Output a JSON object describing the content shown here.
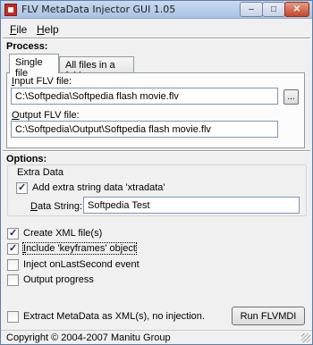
{
  "window": {
    "title": "FLV MetaData Injector GUI 1.05",
    "buttons": {
      "minimize": "–",
      "maximize": "□",
      "close": "✕"
    }
  },
  "menu": {
    "file_first": "F",
    "file_rest": "ile",
    "help_first": "H",
    "help_rest": "elp"
  },
  "process": {
    "label": "Process:",
    "tabs": [
      {
        "label": "Single file",
        "active": true
      },
      {
        "label": "All files in a folder",
        "active": false
      }
    ],
    "input_label_first": "I",
    "input_label_rest": "nput FLV file:",
    "input_value": "C:\\Softpedia\\Softpedia flash movie.flv",
    "browse_label": "...",
    "output_label_first": "O",
    "output_label_rest": "utput FLV file:",
    "output_value": "C:\\Softpedia\\Output\\Softpedia flash movie.flv"
  },
  "options": {
    "label": "Options:",
    "extra_data": {
      "title": "Extra Data",
      "add_label": "Add extra string data 'xtradata'",
      "add_checked": true,
      "string_label_first": "D",
      "string_label_rest": "ata String:",
      "string_value": "Softpedia Test"
    },
    "checks": [
      {
        "first": "",
        "label": "Create XML file(s)",
        "checked": true
      },
      {
        "first": "I",
        "label": "nclude 'keyframes' object",
        "checked": true
      },
      {
        "first": "",
        "label": "Inject onLastSecond event",
        "checked": false
      },
      {
        "first": "",
        "label": "Output progress",
        "checked": false
      }
    ],
    "extract_label": "Extract MetaData as XML(s), no injection.",
    "extract_checked": false
  },
  "run_button": "Run FLVMDI",
  "status": "Copyright © 2004-2007 Manitu Group"
}
